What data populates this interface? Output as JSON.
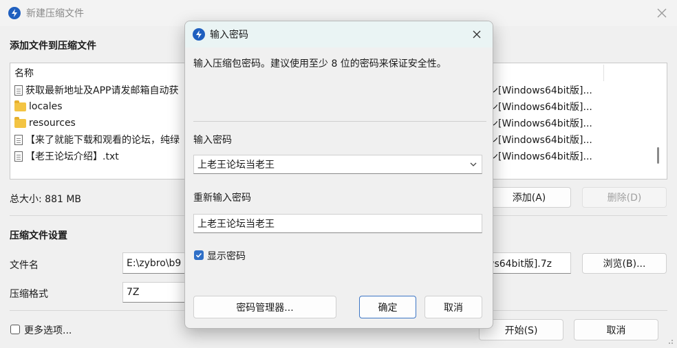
{
  "main": {
    "title": "新建压缩文件",
    "add_section_label": "添加文件到压缩文件",
    "list": {
      "column_name": "名称",
      "rows": [
        {
          "icon": "file-icon",
          "name": "获取最新地址及APP请发邮箱自动获",
          "right": "ン[Windows64bit版]..."
        },
        {
          "icon": "folder-icon",
          "name": "locales",
          "right": "ン[Windows64bit版]..."
        },
        {
          "icon": "folder-icon",
          "name": "resources",
          "right": "ン[Windows64bit版]..."
        },
        {
          "icon": "file-icon",
          "name": "【来了就能下载和观看的论坛，纯绿",
          "right": "ン[Windows64bit版]..."
        },
        {
          "icon": "file-icon",
          "name": "【老王论坛介绍】.txt",
          "right": "ン[Windows64bit版]..."
        }
      ]
    },
    "total_size": "总大小: 881 MB",
    "add_button": "添加(A)",
    "delete_button": "删除(D)",
    "settings_label": "压缩文件设置",
    "filename_label": "文件名",
    "filename_left": "E:\\zybro\\b9",
    "filename_right": "ws64bit版].7z",
    "browse_button": "浏览(B)...",
    "format_label": "压缩格式",
    "format_value": "7Z",
    "more_options": "更多选项...",
    "start_button": "开始(S)",
    "cancel_button": "取消"
  },
  "dialog": {
    "title": "输入密码",
    "description": "输入压缩包密码。建议使用至少 8 位的密码来保证安全性。",
    "password_label": "输入密码",
    "password_value": "上老王论坛当老王",
    "reenter_label": "重新输入密码",
    "reenter_value": "上老王论坛当老王",
    "show_password_label": "显示密码",
    "show_password_checked": true,
    "manager_button": "密码管理器...",
    "ok_button": "确定",
    "cancel_button": "取消"
  },
  "colors": {
    "accent": "#2f6fc7",
    "app_icon": "#1f5fbf"
  }
}
